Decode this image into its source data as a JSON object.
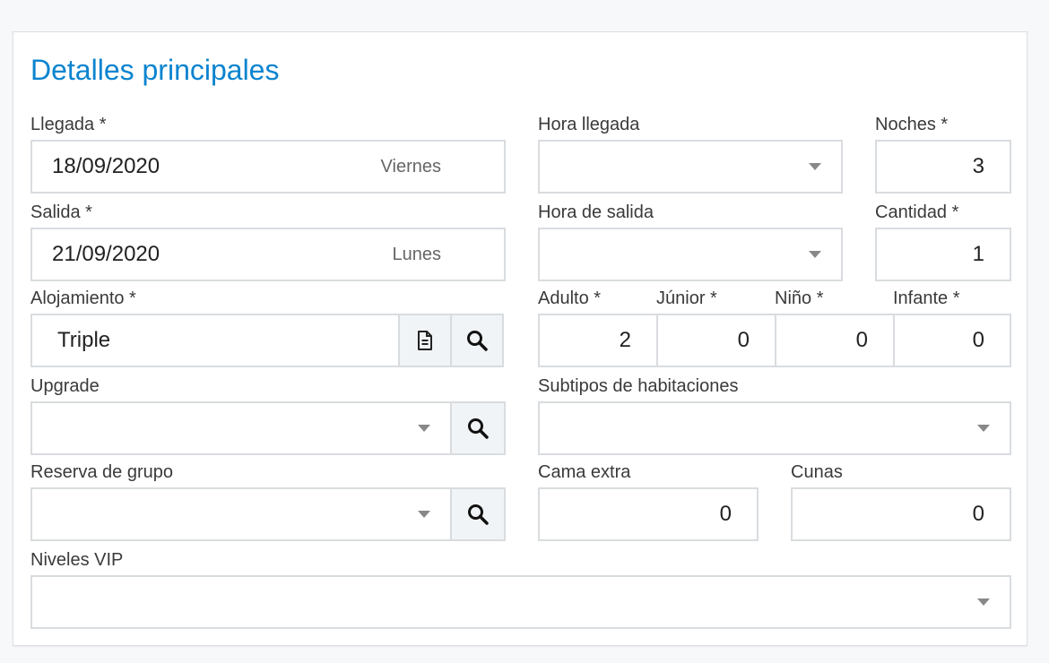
{
  "section": {
    "title": "Detalles principales"
  },
  "llegada": {
    "label": "Llegada *",
    "value": "18/09/2020",
    "day": "Viernes"
  },
  "hora_llegada": {
    "label": "Hora llegada",
    "value": ""
  },
  "noches": {
    "label": "Noches *",
    "value": "3"
  },
  "salida": {
    "label": "Salida *",
    "value": "21/09/2020",
    "day": "Lunes"
  },
  "hora_salida": {
    "label": "Hora de salida",
    "value": ""
  },
  "cantidad": {
    "label": "Cantidad *",
    "value": "1"
  },
  "alojamiento": {
    "label": "Alojamiento *",
    "value": "Triple"
  },
  "occupancy": {
    "adulto": {
      "label": "Adulto *",
      "value": "2"
    },
    "junior": {
      "label": "Júnior *",
      "value": "0"
    },
    "nino": {
      "label": "Niño *",
      "value": "0"
    },
    "infante": {
      "label": "Infante *",
      "value": "0"
    }
  },
  "upgrade": {
    "label": "Upgrade",
    "value": ""
  },
  "subtipos": {
    "label": "Subtipos de habitaciones",
    "value": ""
  },
  "reserva_grupo": {
    "label": "Reserva de grupo",
    "value": ""
  },
  "cama_extra": {
    "label": "Cama extra",
    "value": "0"
  },
  "cunas": {
    "label": "Cunas",
    "value": "0"
  },
  "niveles_vip": {
    "label": "Niveles VIP",
    "value": ""
  },
  "colors": {
    "accent": "#0b84cf",
    "border": "#d9dcdf",
    "button_bg": "#f1f4f6"
  },
  "icons": [
    "document-icon",
    "search-icon",
    "caret-down-icon"
  ]
}
